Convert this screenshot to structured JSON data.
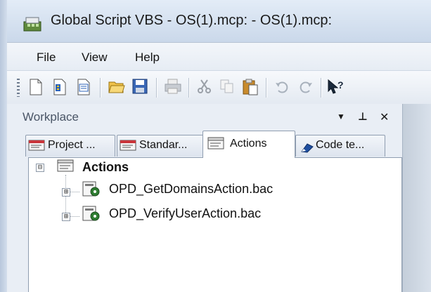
{
  "window": {
    "title": "Global Script VBS - OS(1).mcp: - OS(1).mcp:"
  },
  "menu": {
    "items": [
      "File",
      "View",
      "Help"
    ]
  },
  "toolbar": {
    "buttons": [
      "new-icon",
      "new-project-icon",
      "new-action-icon",
      "open-icon",
      "save-icon",
      "print-icon",
      "cut-icon",
      "copy-icon",
      "paste-icon",
      "undo-icon",
      "redo-icon",
      "help-pointer-icon"
    ]
  },
  "workplace": {
    "title": "Workplace",
    "controls": {
      "dropdown": "▼",
      "pin": "⊥",
      "close": "✕"
    },
    "tabs": [
      {
        "label": "Project ...",
        "icon": "function-icon"
      },
      {
        "label": "Standar...",
        "icon": "function-icon"
      },
      {
        "label": "Actions",
        "icon": "actions-icon",
        "active": true
      },
      {
        "label": "Code te...",
        "icon": "code-template-icon"
      }
    ],
    "tree": {
      "root": {
        "label": "Actions",
        "expander": "⊟"
      },
      "children": [
        {
          "label": "OPD_GetDomainsAction.bac",
          "expander": "⊞"
        },
        {
          "label": "OPD_VerifyUserAction.bac",
          "expander": "⊞"
        }
      ]
    }
  }
}
